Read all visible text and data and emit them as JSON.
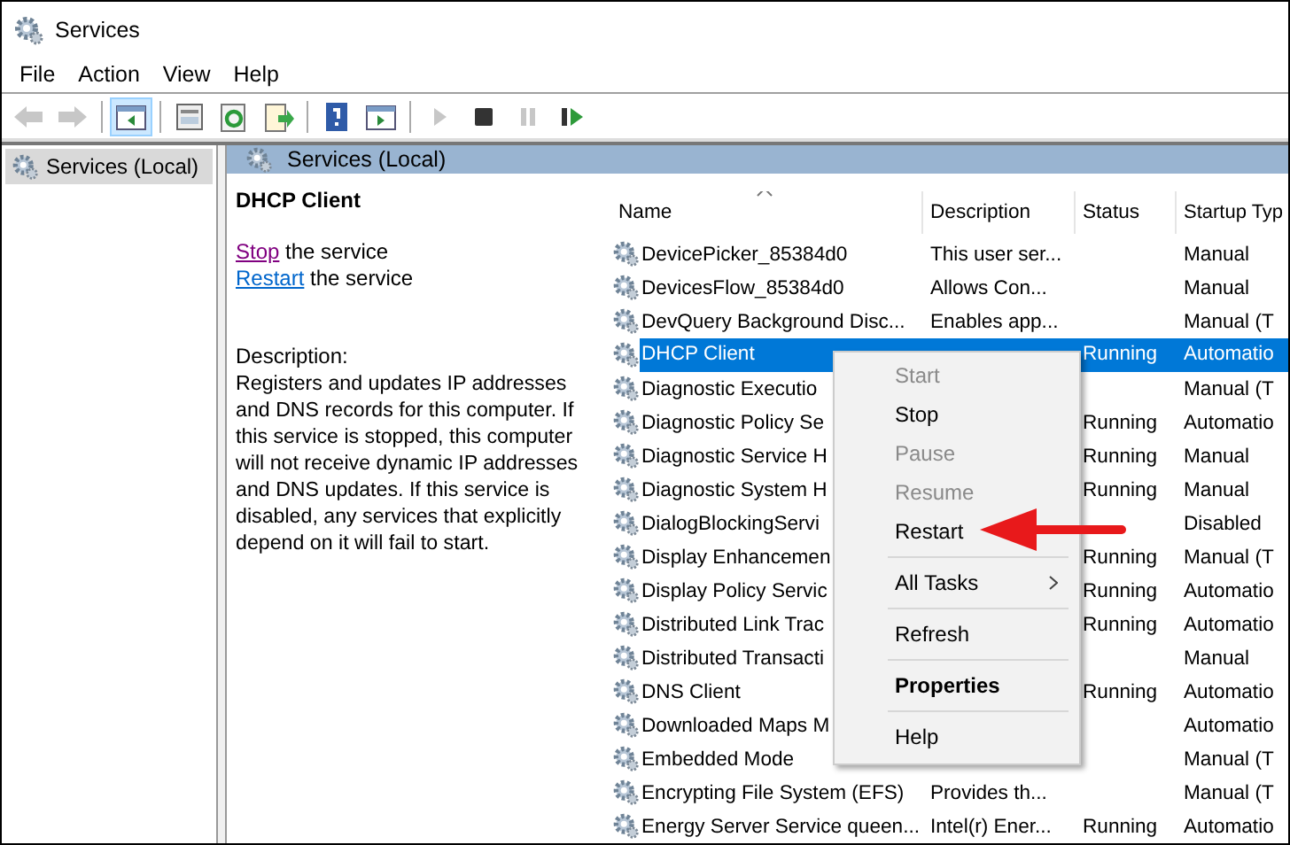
{
  "window": {
    "title": "Services"
  },
  "menu_bar": [
    "File",
    "Action",
    "View",
    "Help"
  ],
  "toolbar": [
    {
      "kind": "back",
      "disabled": true,
      "selected": false
    },
    {
      "kind": "forward",
      "disabled": true,
      "selected": false
    },
    {
      "kind": "sep"
    },
    {
      "kind": "console-tree",
      "disabled": false,
      "selected": true
    },
    {
      "kind": "sep"
    },
    {
      "kind": "properties",
      "disabled": false,
      "selected": false
    },
    {
      "kind": "refresh",
      "disabled": false,
      "selected": false
    },
    {
      "kind": "export",
      "disabled": false,
      "selected": false
    },
    {
      "kind": "sep"
    },
    {
      "kind": "help",
      "disabled": false,
      "selected": false
    },
    {
      "kind": "action-pane",
      "disabled": false,
      "selected": false
    },
    {
      "kind": "sep"
    },
    {
      "kind": "play",
      "disabled": true,
      "selected": false
    },
    {
      "kind": "stop",
      "disabled": false,
      "selected": false
    },
    {
      "kind": "pause",
      "disabled": true,
      "selected": false
    },
    {
      "kind": "resume",
      "disabled": false,
      "selected": false
    }
  ],
  "tree": {
    "items": [
      {
        "label": "Services (Local)",
        "selected": true
      }
    ]
  },
  "pane_header": "Services (Local)",
  "detail": {
    "title": "DHCP Client",
    "actions": [
      {
        "link": "Stop",
        "text": "the service",
        "visited": true
      },
      {
        "link": "Restart",
        "text": "the service",
        "visited": false
      }
    ],
    "description_label": "Description:",
    "description": "Registers and updates IP addresses and DNS records for this computer. If this service is stopped, this computer will not receive dynamic IP addresses and DNS updates. If this service is disabled, any services that explicitly depend on it will fail to start."
  },
  "table": {
    "columns": [
      "Name",
      "Description",
      "Status",
      "Startup Typ"
    ],
    "rows": [
      {
        "name": "DevicePicker_85384d0",
        "description": "This user ser...",
        "startup": "Manual",
        "selected": false
      },
      {
        "name": "DevicesFlow_85384d0",
        "description": "Allows Con...",
        "startup": "Manual",
        "selected": false
      },
      {
        "name": "DevQuery Background Disc...",
        "description": "Enables app...",
        "startup": "Manual (T",
        "selected": false
      },
      {
        "name": "DHCP Client",
        "status": "Running",
        "startup": "Automatio",
        "selected": true
      },
      {
        "name": "Diagnostic Executio",
        "startup": "Manual (T",
        "selected": false
      },
      {
        "name": "Diagnostic Policy Se",
        "status": "Running",
        "startup": "Automatio",
        "selected": false
      },
      {
        "name": "Diagnostic Service H",
        "status": "Running",
        "startup": "Manual",
        "selected": false
      },
      {
        "name": "Diagnostic System H",
        "status": "Running",
        "startup": "Manual",
        "selected": false
      },
      {
        "name": "DialogBlockingServi",
        "startup": "Disabled",
        "selected": false
      },
      {
        "name": "Display Enhancemen",
        "status": "Running",
        "startup": "Manual (T",
        "selected": false
      },
      {
        "name": "Display Policy Servic",
        "status": "Running",
        "startup": "Automatio",
        "selected": false
      },
      {
        "name": "Distributed Link Trac",
        "status": "Running",
        "startup": "Automatio",
        "selected": false
      },
      {
        "name": "Distributed Transacti",
        "startup": "Manual",
        "selected": false
      },
      {
        "name": "DNS Client",
        "status": "Running",
        "startup": "Automatio",
        "selected": false
      },
      {
        "name": "Downloaded Maps M",
        "startup": "Automatio",
        "selected": false
      },
      {
        "name": "Embedded Mode",
        "startup": "Manual (T",
        "selected": false
      },
      {
        "name": "Encrypting File System (EFS)",
        "description": "Provides th...",
        "startup": "Manual (T",
        "selected": false
      },
      {
        "name": "Energy Server Service queen...",
        "description": "Intel(r) Ener...",
        "status": "Running",
        "startup": "Automatio",
        "selected": false
      }
    ]
  },
  "context_menu": [
    {
      "kind": "command",
      "label": "Start",
      "disabled": true,
      "bold": false
    },
    {
      "kind": "command",
      "label": "Stop",
      "disabled": false,
      "bold": false
    },
    {
      "kind": "command",
      "label": "Pause",
      "disabled": true,
      "bold": false
    },
    {
      "kind": "command",
      "label": "Resume",
      "disabled": true,
      "bold": false
    },
    {
      "kind": "command",
      "label": "Restart",
      "disabled": false,
      "bold": false
    },
    {
      "kind": "separator"
    },
    {
      "kind": "submenu",
      "label": "All Tasks",
      "disabled": false,
      "bold": false
    },
    {
      "kind": "separator"
    },
    {
      "kind": "command",
      "label": "Refresh",
      "disabled": false,
      "bold": false
    },
    {
      "kind": "separator"
    },
    {
      "kind": "command",
      "label": "Properties",
      "disabled": false,
      "bold": true
    },
    {
      "kind": "separator"
    },
    {
      "kind": "command",
      "label": "Help",
      "disabled": false,
      "bold": false
    }
  ]
}
